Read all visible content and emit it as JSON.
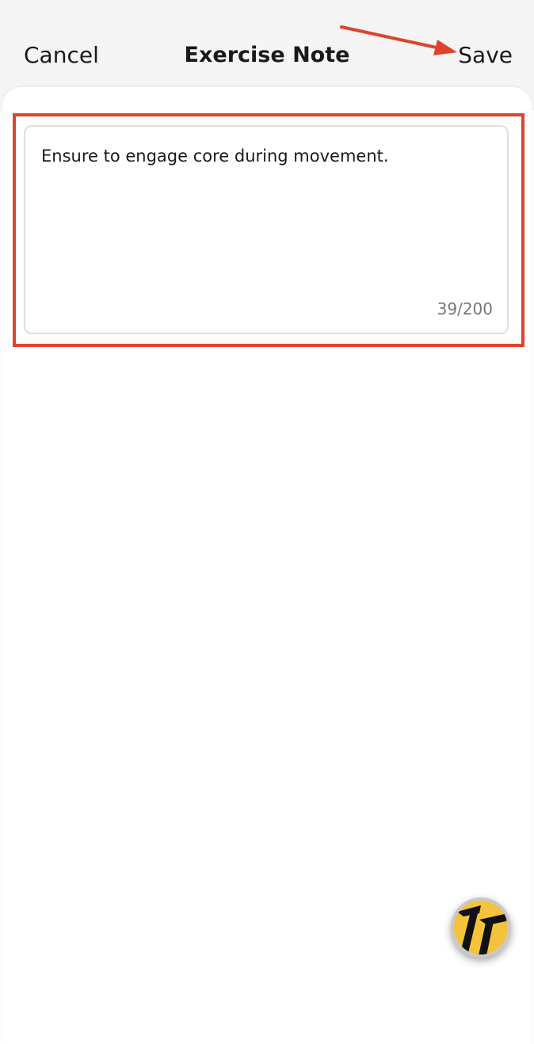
{
  "header": {
    "cancel_label": "Cancel",
    "title": "Exercise Note",
    "save_label": "Save"
  },
  "note": {
    "text": "Ensure to engage core during movement.",
    "char_count": "39/200"
  },
  "colors": {
    "annotation": "#e0432d",
    "logo_fill": "#f5c33b"
  },
  "icons": {
    "annotation_arrow": "arrow-icon",
    "floating_logo": "brand-logo-icon"
  }
}
